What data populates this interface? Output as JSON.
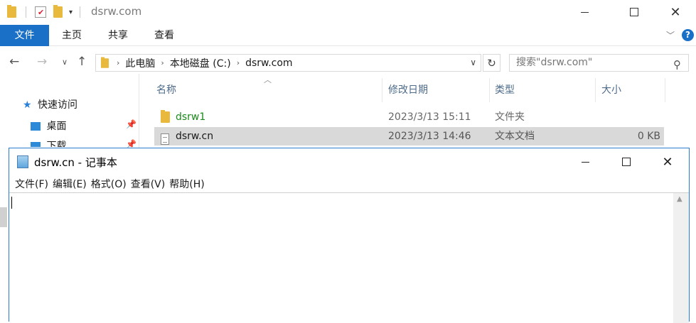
{
  "explorer": {
    "title": "dsrw.com",
    "ribbon_tabs": [
      "文件",
      "主页",
      "共享",
      "查看"
    ],
    "help_label": "?",
    "address": {
      "crumbs": [
        "此电脑",
        "本地磁盘 (C:)",
        "dsrw.com"
      ]
    },
    "search": {
      "placeholder": "搜索\"dsrw.com\""
    },
    "nav": {
      "quick_access": "快速访问",
      "items": [
        "桌面",
        "下载"
      ]
    },
    "columns": {
      "name": "名称",
      "modified": "修改日期",
      "type": "类型",
      "size": "大小"
    },
    "files": [
      {
        "name": "dsrw1",
        "modified": "2023/3/13 15:11",
        "type": "文件夹",
        "size": "",
        "icon": "folder-icon",
        "color": "#1b8a1b"
      },
      {
        "name": "dsrw.cn",
        "modified": "2023/3/13 14:46",
        "type": "文本文档",
        "size": "0 KB",
        "icon": "text-file-icon",
        "selected": true
      }
    ],
    "colors": {
      "accent": "#1a6fc7",
      "folder": "#e8b93d",
      "selected_row": "#d9d9d9"
    }
  },
  "notepad": {
    "title": "dsrw.cn - 记事本",
    "menu": [
      "文件(F)",
      "编辑(E)",
      "格式(O)",
      "查看(V)",
      "帮助(H)"
    ],
    "content": ""
  }
}
